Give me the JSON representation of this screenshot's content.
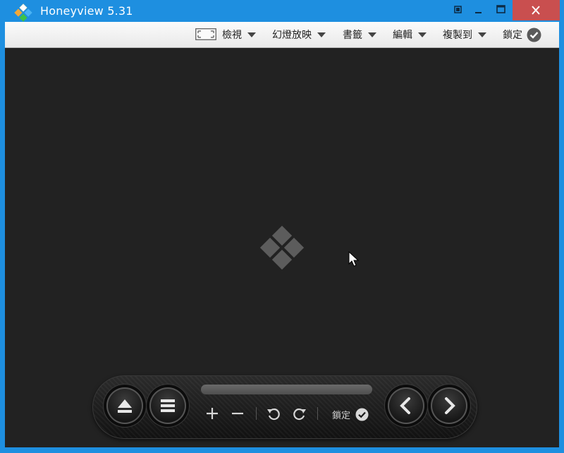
{
  "window": {
    "title": "Honeyview 5.31"
  },
  "menu": {
    "items": [
      {
        "label": "檢視"
      },
      {
        "label": "幻燈放映"
      },
      {
        "label": "書籤"
      },
      {
        "label": "編輯"
      },
      {
        "label": "複製到"
      }
    ],
    "lock_label": "鎖定"
  },
  "controls": {
    "lock_label": "鎖定"
  },
  "icons": {
    "logo": "honeyview-logo-icon",
    "view_mode": "fit-window-icon",
    "lock_check": "check-circle-icon",
    "eject": "eject-icon",
    "menu": "hamburger-icon",
    "zoom_in": "plus-icon",
    "zoom_out": "minus-icon",
    "rotate_left": "rotate-left-icon",
    "rotate_right": "rotate-right-icon",
    "prev": "chevron-left-icon",
    "next": "chevron-right-icon"
  },
  "colors": {
    "titlebar": "#1e8fe0",
    "close_button": "#c94f4f",
    "viewer_background": "#222222",
    "menubar": "#efefef"
  }
}
